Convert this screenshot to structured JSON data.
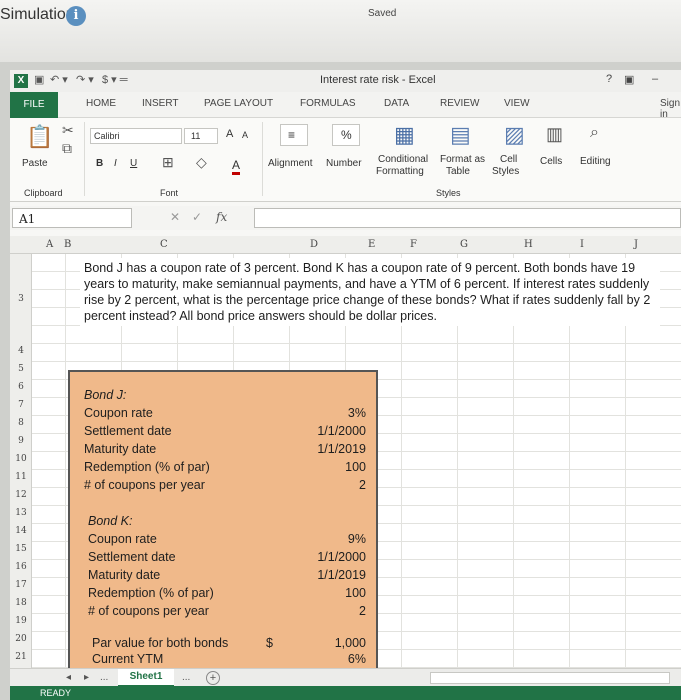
{
  "page": {
    "title": "Simulation",
    "status": "Saved"
  },
  "excel": {
    "window_title": "Interest rate risk - Excel",
    "help": "?",
    "tabs": [
      "FILE",
      "HOME",
      "INSERT",
      "PAGE LAYOUT",
      "FORMULAS",
      "DATA",
      "REVIEW",
      "VIEW",
      "Sign in"
    ],
    "ribbon": {
      "paste": "Paste",
      "font_name": "Calibri",
      "font_size": "11",
      "font_grow": "A",
      "font_shrink": "A",
      "bold": "B",
      "italic": "I",
      "underline": "U",
      "font_color": "A",
      "alignment": "Alignment",
      "number": "Number",
      "percent": "%",
      "conditional_1": "Conditional",
      "conditional_2": "Formatting",
      "format_table_1": "Format as",
      "format_table_2": "Table",
      "cell_styles_1": "Cell",
      "cell_styles_2": "Styles",
      "cells": "Cells",
      "editing": "Editing",
      "clipboard_group": "Clipboard",
      "font_group": "Font",
      "styles_group": "Styles"
    },
    "name_box": "A1",
    "fx": "fx",
    "columns": [
      "A",
      "B",
      "C",
      "D",
      "E",
      "F",
      "G",
      "H",
      "I",
      "J"
    ],
    "rows": [
      "3",
      "4",
      "5",
      "6",
      "7",
      "8",
      "9",
      "10",
      "11",
      "12",
      "13",
      "14",
      "15",
      "16",
      "17",
      "18",
      "19",
      "20",
      "21"
    ],
    "question": "Bond J has a coupon rate of 3 percent. Bond K has a coupon rate of 9 percent. Both bonds have 19 years to maturity, make semiannual payments, and have a YTM of 6 percent. If interest rates suddenly rise by 2 percent, what is the percentage price change of these bonds? What if rates suddenly fall by 2 percent instead? All bond price answers should be dollar prices.",
    "bond_j": {
      "header": "Bond J:",
      "rows": [
        {
          "label": "Coupon rate",
          "value": "3%"
        },
        {
          "label": "Settlement date",
          "value": "1/1/2000"
        },
        {
          "label": "Maturity date",
          "value": "1/1/2019"
        },
        {
          "label": "Redemption (% of par)",
          "value": "100"
        },
        {
          "label": "# of coupons per year",
          "value": "2"
        }
      ]
    },
    "bond_k": {
      "header": "Bond K:",
      "rows": [
        {
          "label": "Coupon rate",
          "value": "9%"
        },
        {
          "label": "Settlement date",
          "value": "1/1/2000"
        },
        {
          "label": "Maturity date",
          "value": "1/1/2019"
        },
        {
          "label": "Redemption (% of par)",
          "value": "100"
        },
        {
          "label": "# of coupons per year",
          "value": "2"
        }
      ]
    },
    "par": {
      "label": "Par value for both bonds",
      "currency": "$",
      "value": "1,000"
    },
    "ytm": {
      "label": "Current YTM",
      "value": "6%"
    },
    "sheet_tab": "Sheet1",
    "sheet_more": "...",
    "status": "READY"
  }
}
